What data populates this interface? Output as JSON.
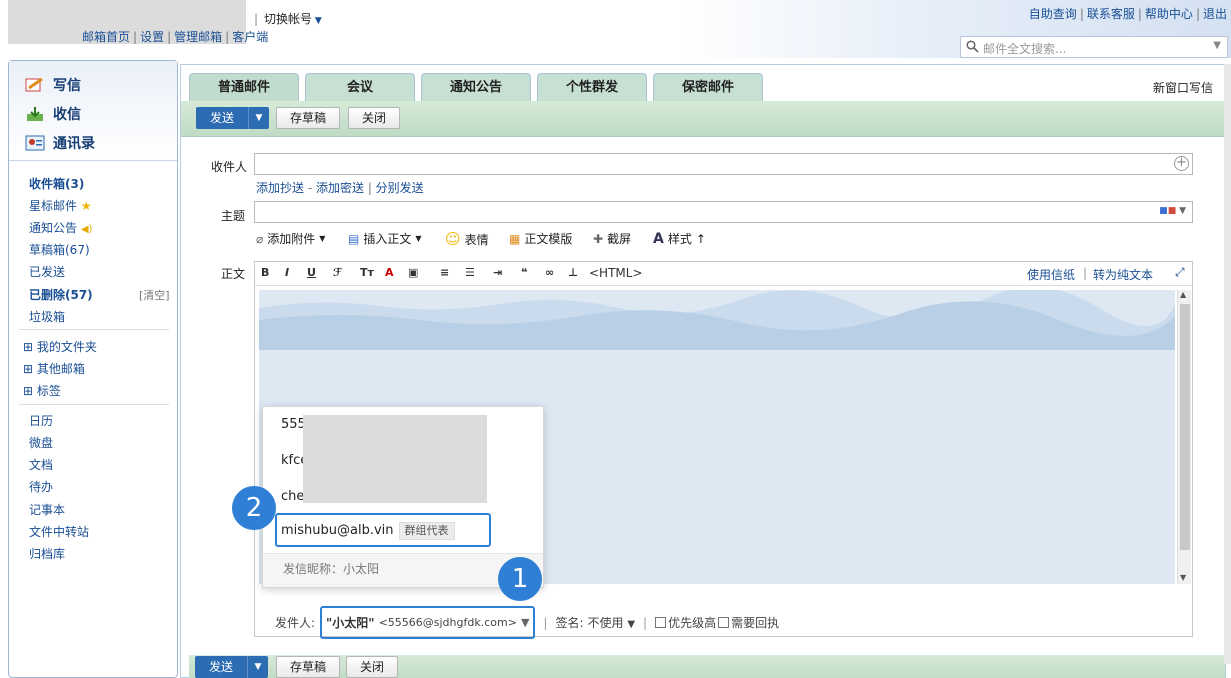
{
  "header": {
    "switch_account": "切换帐号",
    "nav": [
      "邮箱首页",
      "设置",
      "管理邮箱",
      "客户端"
    ],
    "right_links": [
      "自助查询",
      "联系客服",
      "帮助中心",
      "退出"
    ],
    "search_placeholder": "邮件全文搜索..."
  },
  "sidebar": {
    "compose": "写信",
    "receive": "收信",
    "contacts": "通讯录",
    "folders": [
      {
        "label": "收件箱(3)",
        "bold": true
      },
      {
        "label": "星标邮件"
      },
      {
        "label": "通知公告"
      },
      {
        "label": "草稿箱(67)"
      },
      {
        "label": "已发送"
      },
      {
        "label": "已删除(57)",
        "bold": true
      },
      {
        "label": "垃圾箱"
      }
    ],
    "clear_label": "[清空]",
    "groups": [
      "⊞ 我的文件夹",
      "⊞ 其他邮箱",
      "⊞ 标签"
    ],
    "tools": [
      "日历",
      "微盘",
      "文档",
      "待办",
      "记事本",
      "文件中转站",
      "归档库"
    ]
  },
  "tabs": [
    "普通邮件",
    "会议",
    "通知公告",
    "个性群发",
    "保密邮件"
  ],
  "new_window": "新窗口写信",
  "toolbar": {
    "send": "发送",
    "draft": "存草稿",
    "close": "关闭"
  },
  "form": {
    "to_label": "收件人",
    "cc_links": [
      "添加抄送",
      "添加密送",
      "分别发送"
    ],
    "subject_label": "主题",
    "attach_tools": [
      "添加附件",
      "插入正文",
      "表情",
      "正文模版",
      "截屏",
      "样式"
    ],
    "body_label": "正文",
    "editor_tools": [
      "B",
      "I",
      "U",
      "<HTML>"
    ],
    "editor_right": [
      "使用信纸",
      "转为纯文本"
    ]
  },
  "popup": {
    "items": [
      "555",
      "kfce",
      "chen"
    ],
    "selected": "mishubu@alb.vin",
    "selected_tag": "群组代表",
    "nickname": "发信昵称：小太阳"
  },
  "sender": {
    "label": "发件人:",
    "name": "\"小太阳\"",
    "email": "<55566@sjdhgfdk.com>",
    "signature_label": "签名:",
    "signature_value": "不使用",
    "priority": "优先级高",
    "receipt": "需要回执"
  },
  "badges": [
    "1",
    "2"
  ]
}
